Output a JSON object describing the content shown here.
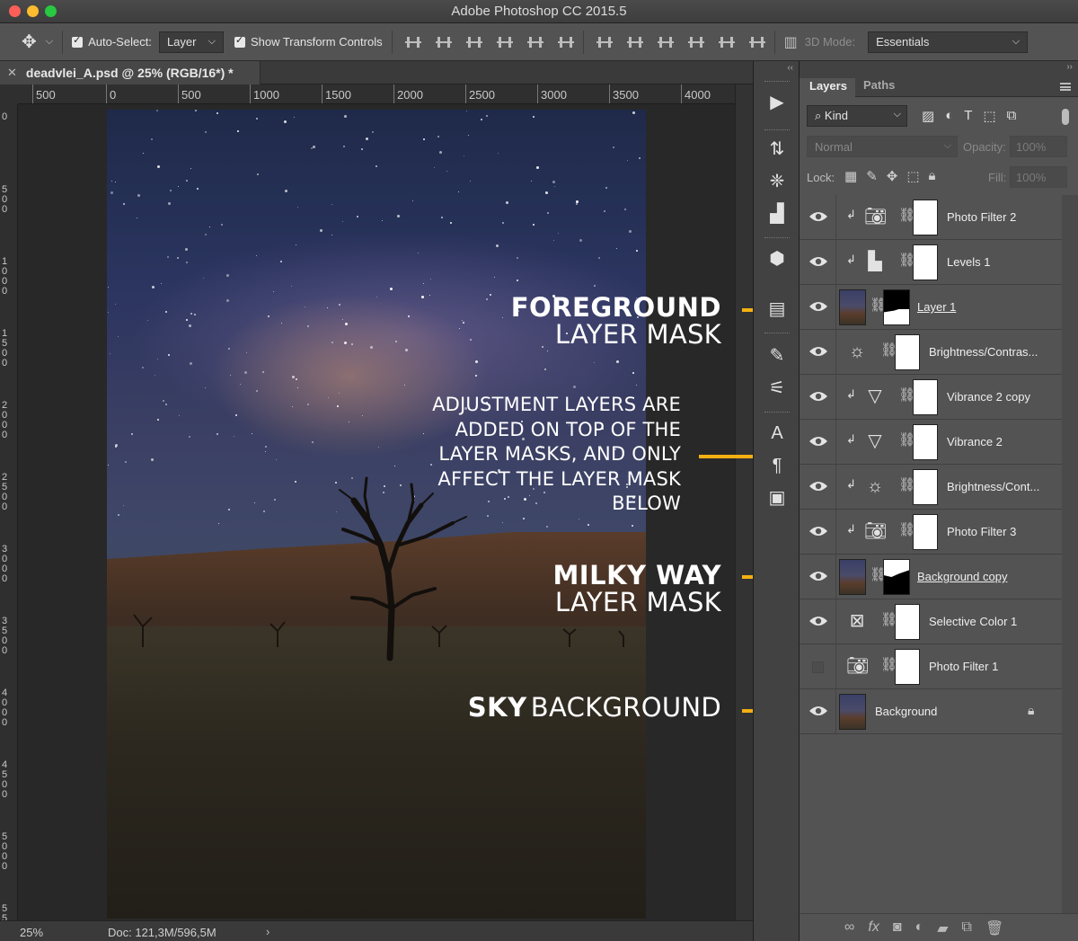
{
  "app": {
    "title": "Adobe Photoshop CC 2015.5"
  },
  "options_bar": {
    "move_tool_icon": "move-arrows-icon",
    "auto_select_label": "Auto-Select:",
    "auto_select_value": "Layer",
    "show_transform_label": "Show Transform Controls",
    "mode_3d_label": "3D Mode:",
    "workspace": "Essentials"
  },
  "document": {
    "tab_title": "deadvlei_A.psd @ 25% (RGB/16*) *",
    "ruler_h": [
      "500",
      "0",
      "500",
      "1000",
      "1500",
      "2000",
      "2500",
      "3000",
      "3500",
      "4000"
    ],
    "ruler_v": [
      "0",
      "5 0 0",
      "1 0 0 0",
      "1 5 0 0",
      "2 0 0 0",
      "2 5 0 0",
      "3 0 0 0",
      "3 5 0 0",
      "4 0 0 0",
      "4 5 0 0",
      "5 0 0 0",
      "5 5"
    ]
  },
  "annotations": {
    "foreground_bold": "FOREGROUND",
    "foreground_light": "LAYER MASK",
    "adjustment_lines": [
      "ADJUSTMENT LAYERS ARE",
      "ADDED ON TOP OF THE",
      "LAYER MASKS, AND ONLY",
      "AFFECT THE LAYER MASK",
      "BELOW"
    ],
    "milkyway_bold": "MILKY WAY",
    "milkyway_light": "LAYER MASK",
    "sky_bold": "SKY",
    "sky_light": "BACKGROUND",
    "arrow_color": "#f4b012"
  },
  "status_bar": {
    "zoom": "25%",
    "doc_info": "Doc: 121,3M/596,5M",
    "more": "›"
  },
  "layers_panel": {
    "tabs": [
      "Layers",
      "Paths"
    ],
    "filter_kind": "Kind",
    "blend_mode": "Normal",
    "opacity_label": "Opacity:",
    "opacity_value": "100%",
    "lock_label": "Lock:",
    "fill_label": "Fill:",
    "fill_value": "100%",
    "layers": [
      {
        "name": "Photo Filter 2",
        "type": "adjustment",
        "icon": "camera-icon",
        "clipped": true,
        "visible": true
      },
      {
        "name": "Levels 1",
        "type": "adjustment",
        "icon": "levels-histogram-icon",
        "clipped": true,
        "visible": true
      },
      {
        "name": "Layer 1",
        "type": "pixel-with-mask",
        "icon": "photo-thumbnail",
        "clipped": false,
        "visible": true
      },
      {
        "name": "Brightness/Contras...",
        "type": "adjustment",
        "icon": "sun-icon",
        "clipped": false,
        "visible": true
      },
      {
        "name": "Vibrance 2 copy",
        "type": "adjustment",
        "icon": "triangle-down-icon",
        "clipped": true,
        "visible": true
      },
      {
        "name": "Vibrance 2",
        "type": "adjustment",
        "icon": "triangle-down-icon",
        "clipped": true,
        "visible": true
      },
      {
        "name": "Brightness/Cont...",
        "type": "adjustment",
        "icon": "sun-icon",
        "clipped": true,
        "visible": true
      },
      {
        "name": "Photo Filter 3",
        "type": "adjustment",
        "icon": "camera-icon",
        "clipped": true,
        "visible": true
      },
      {
        "name": "Background copy",
        "type": "pixel-with-mask",
        "icon": "photo-thumbnail",
        "clipped": false,
        "visible": true
      },
      {
        "name": "Selective Color 1",
        "type": "adjustment",
        "icon": "selective-color-icon",
        "clipped": false,
        "visible": true
      },
      {
        "name": "Photo Filter 1",
        "type": "adjustment",
        "icon": "camera-icon",
        "clipped": false,
        "visible": false
      },
      {
        "name": "Background",
        "type": "background",
        "icon": "photo-thumbnail",
        "clipped": false,
        "visible": true,
        "locked": true
      }
    ]
  }
}
